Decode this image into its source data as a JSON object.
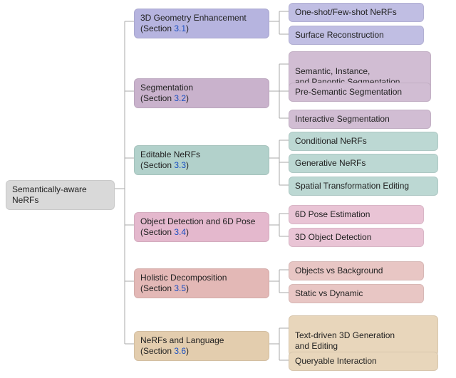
{
  "root": {
    "label": "Semantically-aware NeRFs"
  },
  "sections": [
    {
      "title": "3D Geometry Enhancement",
      "section_prefix": "(Section ",
      "section_number": "3.1",
      "section_suffix": ")",
      "leaves": [
        "One-shot/Few-shot NeRFs",
        "Surface Reconstruction"
      ]
    },
    {
      "title": "Segmentation",
      "section_prefix": "(Section ",
      "section_number": "3.2",
      "section_suffix": ")",
      "leaves": [
        "Semantic, Instance,\nand Panoptic Segmentation",
        "Pre-Semantic Segmentation",
        "Interactive Segmentation"
      ]
    },
    {
      "title": "Editable NeRFs",
      "section_prefix": "(Section ",
      "section_number": "3.3",
      "section_suffix": ")",
      "leaves": [
        "Conditional NeRFs",
        "Generative NeRFs",
        "Spatial Transformation Editing"
      ]
    },
    {
      "title": "Object Detection and 6D Pose",
      "section_prefix": "(Section ",
      "section_number": "3.4",
      "section_suffix": ")",
      "leaves": [
        "6D Pose Estimation",
        "3D Object Detection"
      ]
    },
    {
      "title": "Holistic Decomposition",
      "section_prefix": "(Section ",
      "section_number": "3.5",
      "section_suffix": ")",
      "leaves": [
        "Objects vs Background",
        "Static vs Dynamic"
      ]
    },
    {
      "title": "NeRFs and Language",
      "section_prefix": "(Section ",
      "section_number": "3.6",
      "section_suffix": ")",
      "leaves": [
        "Text-driven 3D Generation\nand Editing",
        "Queryable Interaction"
      ]
    }
  ]
}
